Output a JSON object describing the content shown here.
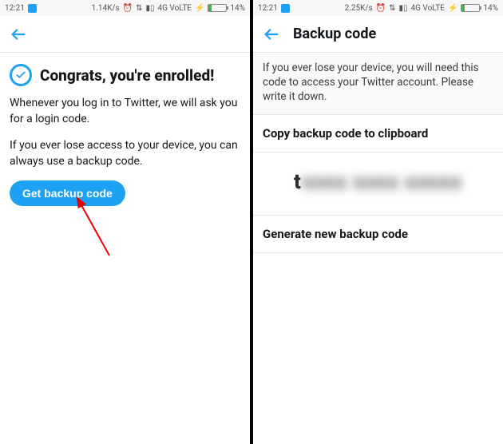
{
  "left": {
    "status": {
      "time": "12:21",
      "speed": "1.14K/s",
      "net": "4G VoLTE",
      "battery": "14%"
    },
    "title": "Congrats, you're enrolled!",
    "body1": "Whenever you log in to Twitter, we will ask you for a login code.",
    "body2": "If you ever lose access to your device, you can always use a backup code.",
    "button": "Get backup code"
  },
  "right": {
    "status": {
      "time": "12:21",
      "speed": "2.25K/s",
      "net": "4G VoLTE",
      "battery": "14%"
    },
    "app_title": "Backup code",
    "info": "If you ever lose your device, you will need this code to access your Twitter account. Please write it down.",
    "copy_label": "Copy backup code to clipboard",
    "code_visible_prefix": "t",
    "generate_label": "Generate new backup code"
  }
}
